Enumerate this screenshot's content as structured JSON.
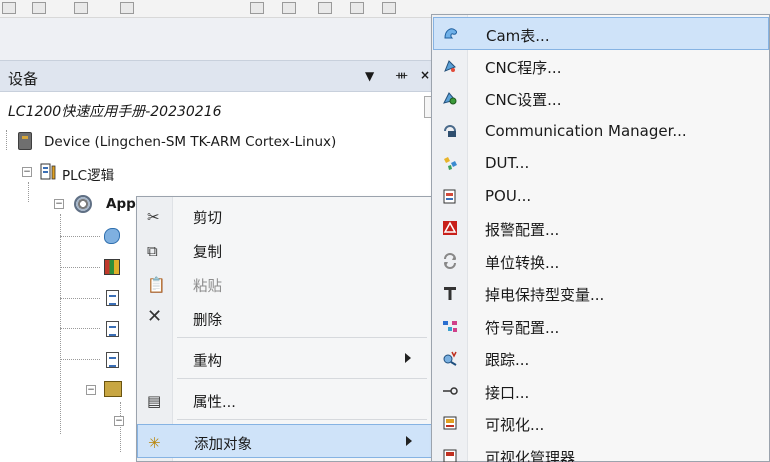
{
  "devices_panel": {
    "title": "设备",
    "project_name": "LC1200快速应用手册-20230216",
    "tree": {
      "device": "Device (Lingchen-SM TK-ARM Cortex-Linux)",
      "plc_logic": "PLC逻辑",
      "application": "App"
    }
  },
  "context_menu": {
    "items": [
      {
        "label": "剪切",
        "icon": "scissors-icon"
      },
      {
        "label": "复制",
        "icon": "copy-icon"
      },
      {
        "label": "粘贴",
        "icon": "paste-icon",
        "disabled": true
      },
      {
        "label": "删除",
        "icon": "delete-icon"
      },
      {
        "label": "重构",
        "has_submenu": true
      },
      {
        "label": "属性...",
        "icon": "properties-icon"
      },
      {
        "label": "添加对象",
        "icon": "add-object-icon",
        "has_submenu": true,
        "highlighted": true
      }
    ]
  },
  "add_object_submenu": {
    "items": [
      {
        "label": "Cam表...",
        "icon": "cam-table-icon",
        "highlighted": true
      },
      {
        "label": "CNC程序...",
        "icon": "cnc-program-icon"
      },
      {
        "label": "CNC设置...",
        "icon": "cnc-settings-icon"
      },
      {
        "label": "Communication Manager...",
        "icon": "communication-manager-icon"
      },
      {
        "label": "DUT...",
        "icon": "dut-icon"
      },
      {
        "label": "POU...",
        "icon": "pou-icon"
      },
      {
        "label": "报警配置...",
        "icon": "alarm-config-icon"
      },
      {
        "label": "单位转换...",
        "icon": "unit-conversion-icon"
      },
      {
        "label": "掉电保持型变量...",
        "icon": "persistent-vars-icon"
      },
      {
        "label": "符号配置...",
        "icon": "symbol-config-icon"
      },
      {
        "label": "跟踪...",
        "icon": "trace-icon"
      },
      {
        "label": "接口...",
        "icon": "interface-icon"
      },
      {
        "label": "可视化...",
        "icon": "visualization-icon"
      },
      {
        "label": "可视化管理器",
        "icon": "visualization-manager-icon"
      }
    ]
  },
  "colors": {
    "highlight": "#cfe3f9",
    "highlight_border": "#86b3e3",
    "panel_header": "#dfe5ef"
  }
}
